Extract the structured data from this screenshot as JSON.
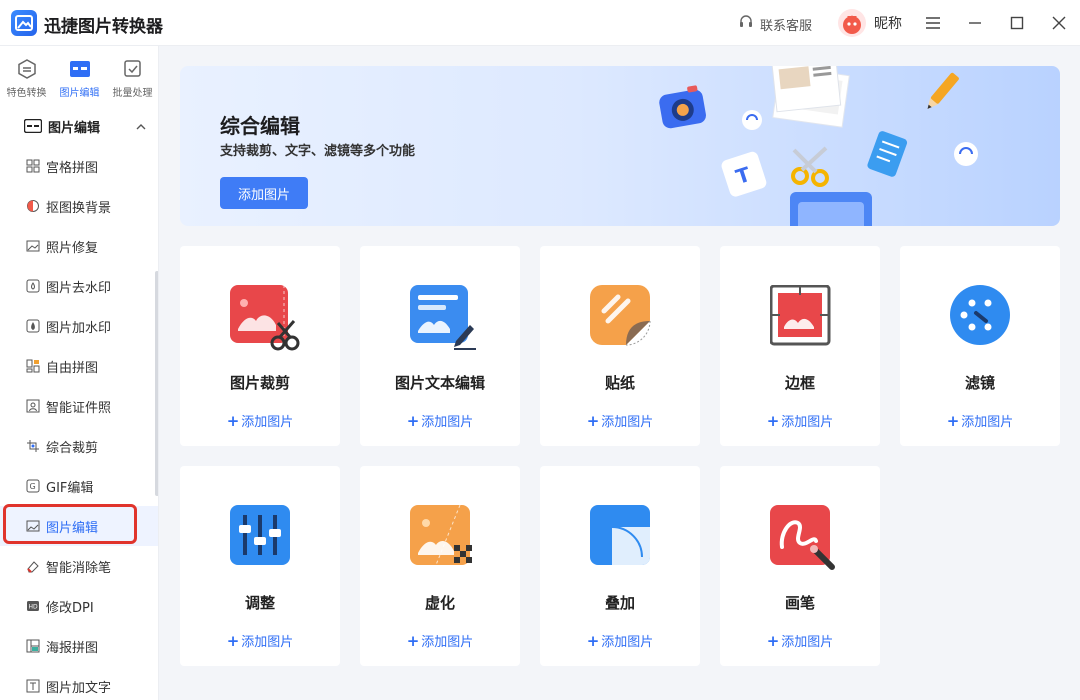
{
  "app": {
    "title": "迅捷图片转换器"
  },
  "header": {
    "support_label": "联系客服",
    "nickname": "昵称"
  },
  "topnav": [
    {
      "label": "特色转换",
      "icon": "refresh-icon"
    },
    {
      "label": "图片编辑",
      "icon": "image-edit-icon"
    },
    {
      "label": "批量处理",
      "icon": "batch-check-icon"
    }
  ],
  "sidebar": {
    "section_title": "图片编辑",
    "items": [
      {
        "label": "宫格拼图"
      },
      {
        "label": "抠图换背景"
      },
      {
        "label": "照片修复"
      },
      {
        "label": "图片去水印"
      },
      {
        "label": "图片加水印"
      },
      {
        "label": "自由拼图"
      },
      {
        "label": "智能证件照"
      },
      {
        "label": "综合裁剪"
      },
      {
        "label": "GIF编辑"
      },
      {
        "label": "图片编辑"
      },
      {
        "label": "智能消除笔"
      },
      {
        "label": "修改DPI"
      },
      {
        "label": "海报拼图"
      },
      {
        "label": "图片加文字"
      }
    ]
  },
  "banner": {
    "title": "综合编辑",
    "subtitle": "支持裁剪、文字、滤镜等多个功能",
    "button": "添加图片"
  },
  "tools": {
    "add_label": "添加图片",
    "items": [
      {
        "title": "图片裁剪"
      },
      {
        "title": "图片文本编辑"
      },
      {
        "title": "贴纸"
      },
      {
        "title": "边框"
      },
      {
        "title": "滤镜"
      },
      {
        "title": "调整"
      },
      {
        "title": "虚化"
      },
      {
        "title": "叠加"
      },
      {
        "title": "画笔"
      }
    ]
  },
  "colors": {
    "accent": "#2f6ef5",
    "highlight_outline": "#e0342c"
  }
}
